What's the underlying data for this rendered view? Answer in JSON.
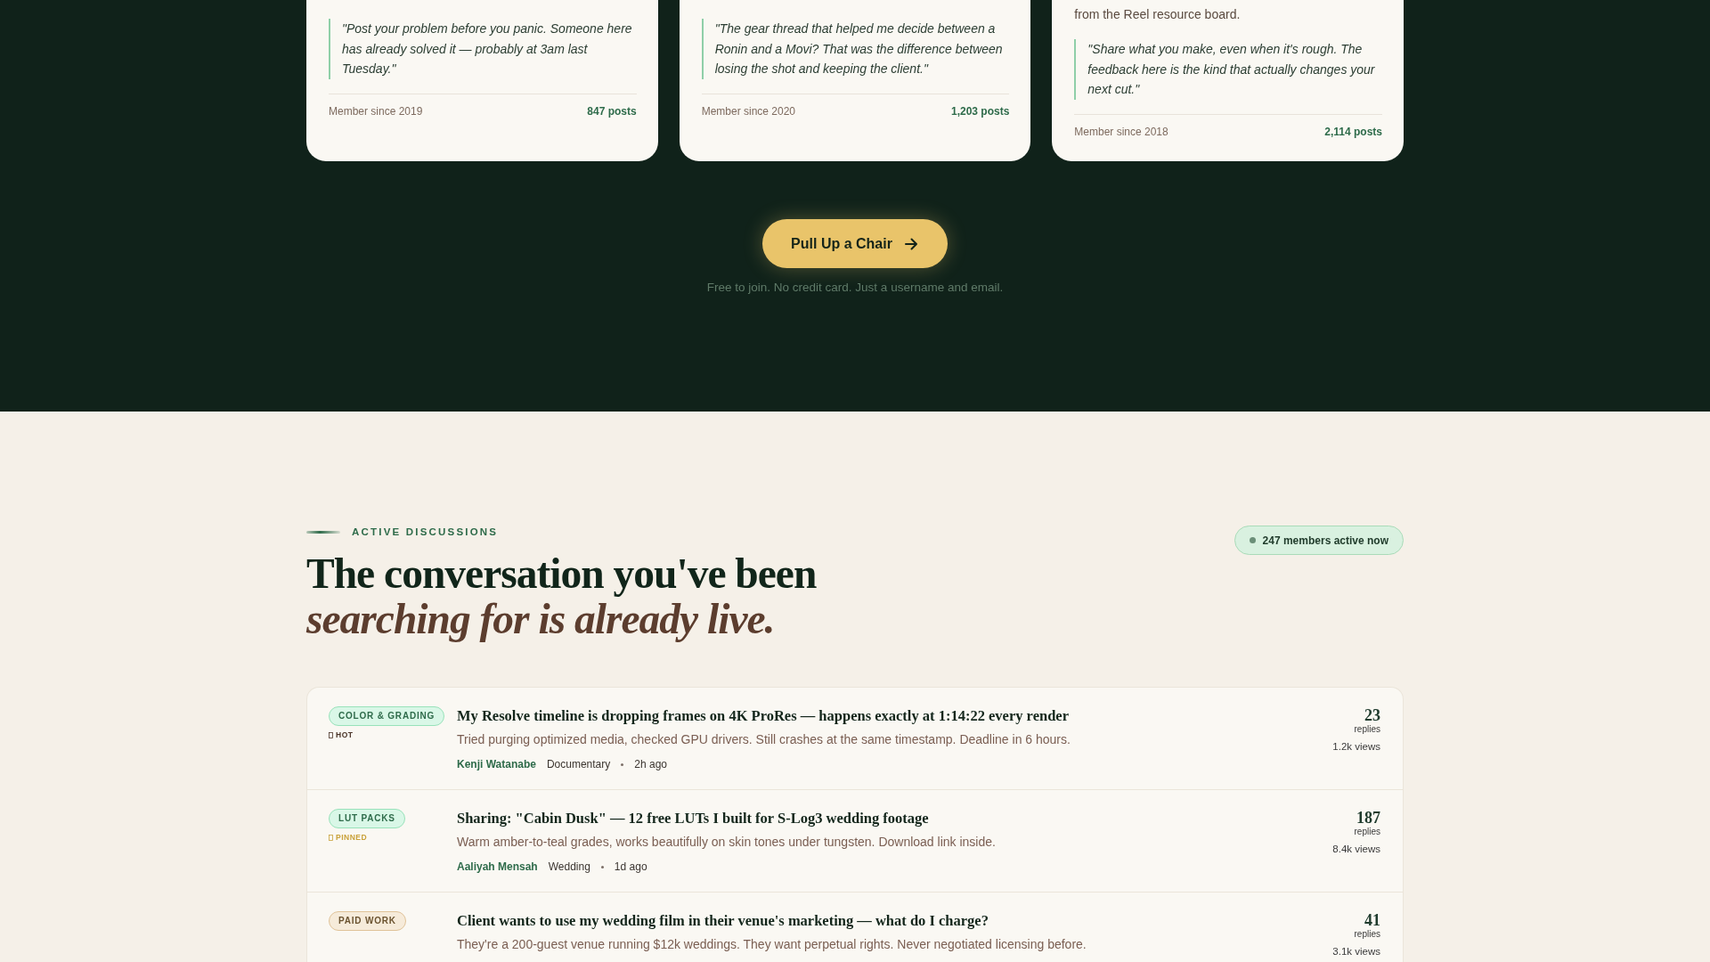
{
  "testimonials": [
    {
      "quote": "\"Post your problem before you panic. Someone here has already solved it — probably at 3am last Tuesday.\"",
      "member_since": "Member since 2019",
      "posts": "847 posts"
    },
    {
      "quote": "\"The gear thread that helped me decide between a Ronin and a Movi? That was the difference between losing the shot and keeping the client.\"",
      "member_since": "Member since 2020",
      "posts": "1,203 posts"
    },
    {
      "text": "from the Reel resource board.",
      "quote": "\"Share what you make, even when it's rough. The feedback here is the kind that actually changes your next cut.\"",
      "member_since": "Member since 2018",
      "posts": "2,114 posts"
    }
  ],
  "cta": {
    "button": "Pull Up a Chair",
    "note": "Free to join. No credit card. Just a username and email."
  },
  "discussions": {
    "eyebrow": "ACTIVE DISCUSSIONS",
    "heading": "The conversation you've been *searching for is already live.*",
    "active_now": "247 members active now",
    "threads": [
      {
        "tag": {
          "label": "COLOR & GRADING",
          "color": "#2e6b4a"
        },
        "flag": {
          "kind": "hot",
          "label": "HOT"
        },
        "title": "My Resolve timeline is dropping frames on 4K ProRes — happens exactly at 1:14:22 every render",
        "excerpt": "Tried purging optimized media, checked GPU drivers. Still crashes at the same timestamp. Deadline in 6 hours.",
        "author": "Kenji Watanabe",
        "specialty": "Documentary",
        "time": "2h ago",
        "replies": "23",
        "replies_label": "replies",
        "views": "1.2k views"
      },
      {
        "tag": {
          "label": "LUT PACKS",
          "color": "#2e6b4a"
        },
        "flag": {
          "kind": "pinned",
          "label": "PINNED"
        },
        "title": "Sharing: \"Cabin Dusk\" — 12 free LUTs I built for S-Log3 wedding footage",
        "excerpt": "Warm amber-to-teal grades, works beautifully on skin tones under tungsten. Download link inside.",
        "author": "Aaliyah Mensah",
        "specialty": "Wedding",
        "time": "1d ago",
        "replies": "187",
        "replies_label": "replies",
        "views": "8.4k views"
      },
      {
        "tag": {
          "label": "PAID WORK",
          "color": "#6b5330"
        },
        "title": "Client wants to use my wedding film in their venue's marketing — what do I charge?",
        "excerpt": "They're a 200-guest venue running $12k weddings. They want perpetual rights. Never negotiated licensing before.",
        "replies": "41",
        "replies_label": "replies",
        "views": "3.1k views"
      }
    ]
  }
}
